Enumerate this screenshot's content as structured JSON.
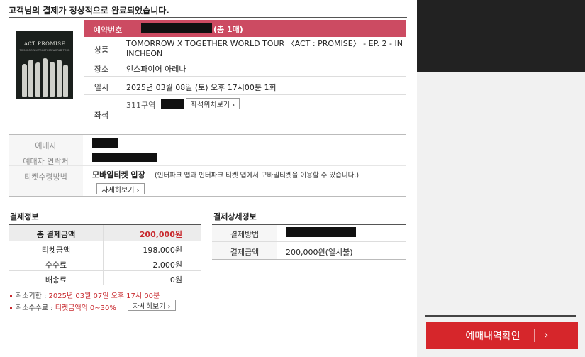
{
  "headline": "고객님의 결제가 정상적으로 완료되었습니다.",
  "poster": {
    "title": "ACT PROMISE",
    "subtitle": "TOMORROW X TOGETHER WORLD TOUR"
  },
  "reservation": {
    "label": "예약번호",
    "count": "(총 1매)",
    "rows": [
      {
        "key": "상품",
        "value": "TOMORROW X TOGETHER WORLD TOUR 〈ACT : PROMISE〉 - EP. 2 - IN INCHEON"
      },
      {
        "key": "장소",
        "value": "인스파이어 아레나"
      },
      {
        "key": "일시",
        "value": "2025년 03월 08일 (토) 오후 17시00분 1회"
      },
      {
        "key": "좌석",
        "value": "311구역"
      }
    ],
    "seat_map_button": "좌석위치보기 ›"
  },
  "booker": {
    "name_label": "예매자",
    "contact_label": "예매자 연락처",
    "ticket_method_label": "티켓수령방법",
    "ticket_method_value": "모바일티켓 입장",
    "ticket_method_note": "(인터파크 앱과 인터파크 티켓 앱에서 모바일티켓을 이용할 수 있습니다.)",
    "details_button": "자세히보기 ›"
  },
  "payment_info": {
    "title": "결제정보",
    "rows": [
      {
        "key": "총 결제금액",
        "value": "200,000원"
      },
      {
        "key": "티켓금액",
        "value": "198,000원"
      },
      {
        "key": "수수료",
        "value": "2,000원"
      },
      {
        "key": "배송료",
        "value": "0원"
      }
    ],
    "notes": [
      {
        "label": "취소기한 :",
        "value": "2025년 03월 07일 오후 17시 00분"
      },
      {
        "label": "취소수수료 :",
        "value": "티켓금액의 0~30%"
      }
    ],
    "details_button": "자세히보기 ›"
  },
  "payment_detail": {
    "title": "결제상세정보",
    "method_label": "결제방법",
    "amount_label": "결제금액",
    "amount_value": "200,000원(일시불)"
  },
  "confirm_button": "예매내역확인",
  "colors": {
    "accent": "#cc4b62",
    "button_red": "#d6262b",
    "total_red": "#c8282d"
  }
}
